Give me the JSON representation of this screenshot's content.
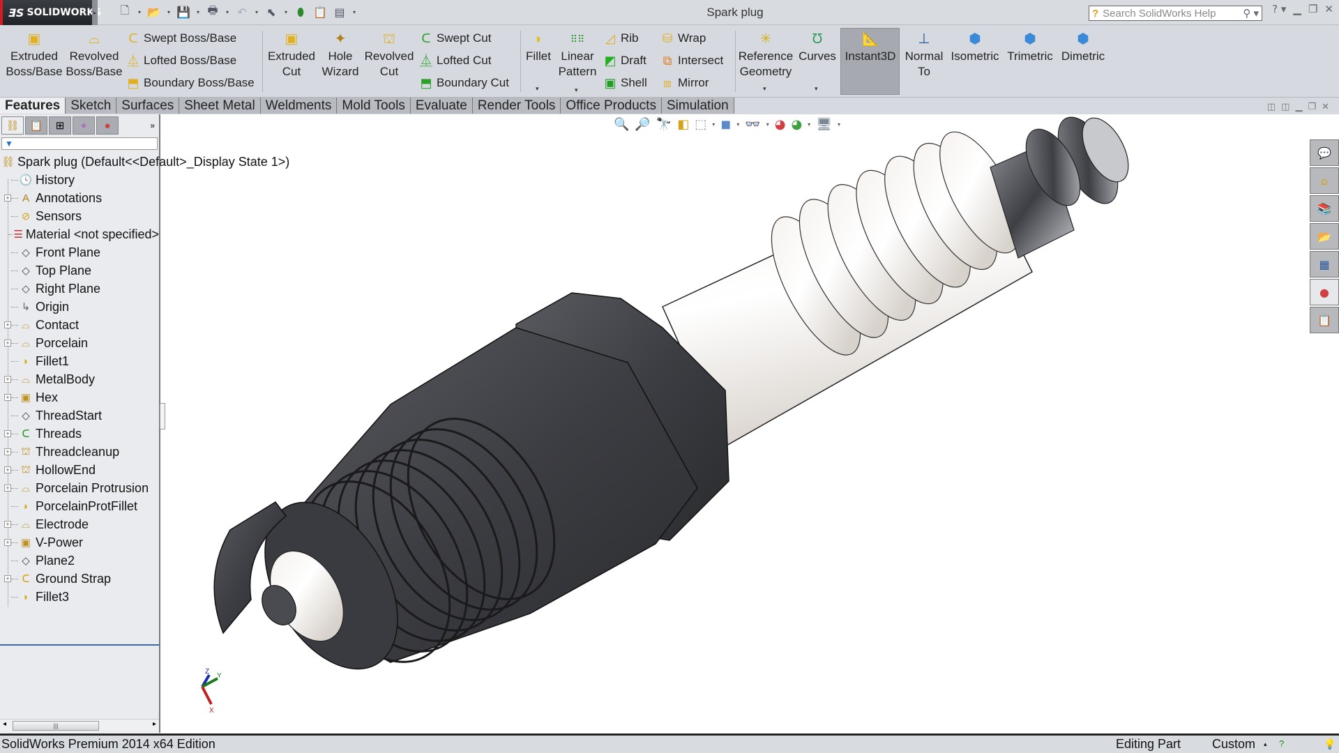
{
  "app": {
    "brand": "SOLIDWORKS",
    "document_title": "Spark plug",
    "search_placeholder": "Search SolidWorks Help"
  },
  "quick_access": [
    {
      "icon": "new-document-icon"
    },
    {
      "icon": "open-folder-icon"
    },
    {
      "icon": "save-icon"
    },
    {
      "icon": "print-icon"
    },
    {
      "icon": "undo-icon"
    },
    {
      "icon": "select-cursor-icon"
    },
    {
      "icon": "rebuild-icon"
    },
    {
      "icon": "file-properties-icon"
    },
    {
      "icon": "options-icon"
    }
  ],
  "command_manager": {
    "big_buttons": [
      {
        "id": "extruded-boss",
        "line1": "Extruded",
        "line2": "Boss/Base"
      },
      {
        "id": "revolved-boss",
        "line1": "Revolved",
        "line2": "Boss/Base"
      },
      {
        "id": "extruded-cut",
        "line1": "Extruded",
        "line2": "Cut"
      },
      {
        "id": "hole-wizard",
        "line1": "Hole",
        "line2": "Wizard"
      },
      {
        "id": "revolved-cut",
        "line1": "Revolved",
        "line2": "Cut"
      },
      {
        "id": "fillet",
        "line1": "Fillet",
        "line2": ""
      },
      {
        "id": "linear-pattern",
        "line1": "Linear",
        "line2": "Pattern"
      },
      {
        "id": "reference-geometry",
        "line1": "Reference",
        "line2": "Geometry"
      },
      {
        "id": "curves",
        "line1": "Curves",
        "line2": ""
      },
      {
        "id": "instant3d",
        "line1": "Instant3D",
        "line2": ""
      },
      {
        "id": "normal-to",
        "line1": "Normal",
        "line2": "To"
      },
      {
        "id": "isometric",
        "line1": "Isometric",
        "line2": ""
      },
      {
        "id": "trimetric",
        "line1": "Trimetric",
        "line2": ""
      },
      {
        "id": "dimetric",
        "line1": "Dimetric",
        "line2": ""
      }
    ],
    "small_buttons": [
      {
        "id": "swept-boss",
        "label": "Swept Boss/Base"
      },
      {
        "id": "lofted-boss",
        "label": "Lofted Boss/Base"
      },
      {
        "id": "boundary-boss",
        "label": "Boundary Boss/Base"
      },
      {
        "id": "swept-cut",
        "label": "Swept Cut"
      },
      {
        "id": "lofted-cut",
        "label": "Lofted Cut"
      },
      {
        "id": "boundary-cut",
        "label": "Boundary Cut"
      },
      {
        "id": "rib",
        "label": "Rib"
      },
      {
        "id": "draft",
        "label": "Draft"
      },
      {
        "id": "shell",
        "label": "Shell"
      },
      {
        "id": "wrap",
        "label": "Wrap"
      },
      {
        "id": "intersect",
        "label": "Intersect"
      },
      {
        "id": "mirror",
        "label": "Mirror"
      }
    ],
    "active": "Instant3D"
  },
  "tabs": [
    "Features",
    "Sketch",
    "Surfaces",
    "Sheet Metal",
    "Weldments",
    "Mold Tools",
    "Evaluate",
    "Render Tools",
    "Office Products",
    "Simulation"
  ],
  "active_tab": "Features",
  "feature_tree": {
    "panel_tabs": [
      "featuremanager-tab",
      "propertymanager-tab",
      "configurationmanager-tab",
      "dimxpert-tab",
      "display-manager-tab"
    ],
    "root": "Spark plug  (Default<<Default>_Display State 1>)",
    "items": [
      {
        "label": "History",
        "icon": "history-icon",
        "expandable": false
      },
      {
        "label": "Annotations",
        "icon": "annotations-icon",
        "expandable": true
      },
      {
        "label": "Sensors",
        "icon": "sensors-icon",
        "expandable": false
      },
      {
        "label": "Material <not specified>",
        "icon": "material-icon",
        "expandable": false
      },
      {
        "label": "Front Plane",
        "icon": "plane-icon",
        "expandable": false
      },
      {
        "label": "Top Plane",
        "icon": "plane-icon",
        "expandable": false
      },
      {
        "label": "Right Plane",
        "icon": "plane-icon",
        "expandable": false
      },
      {
        "label": "Origin",
        "icon": "origin-icon",
        "expandable": false
      },
      {
        "label": "Contact",
        "icon": "revolve-icon",
        "expandable": true
      },
      {
        "label": "Porcelain",
        "icon": "revolve-icon",
        "expandable": true
      },
      {
        "label": "Fillet1",
        "icon": "fillet-icon",
        "expandable": false
      },
      {
        "label": "MetalBody",
        "icon": "revolve-icon",
        "expandable": true
      },
      {
        "label": "Hex",
        "icon": "extrude-icon",
        "expandable": true
      },
      {
        "label": "ThreadStart",
        "icon": "plane-icon",
        "expandable": false
      },
      {
        "label": "Threads",
        "icon": "swept-cut-icon",
        "expandable": true
      },
      {
        "label": "Threadcleanup",
        "icon": "revolved-cut-icon",
        "expandable": true
      },
      {
        "label": "HollowEnd",
        "icon": "revolved-cut-icon",
        "expandable": true
      },
      {
        "label": "Porcelain Protrusion",
        "icon": "revolve-icon",
        "expandable": true
      },
      {
        "label": "PorcelainProtFillet",
        "icon": "fillet-icon",
        "expandable": false
      },
      {
        "label": "Electrode",
        "icon": "revolve-icon",
        "expandable": true
      },
      {
        "label": "V-Power",
        "icon": "extrude-icon",
        "expandable": true
      },
      {
        "label": "Plane2",
        "icon": "plane-icon",
        "expandable": false
      },
      {
        "label": "Ground Strap",
        "icon": "swept-boss-icon",
        "expandable": true
      },
      {
        "label": "Fillet3",
        "icon": "fillet-icon",
        "expandable": false
      }
    ]
  },
  "heads_up_toolbar": [
    "zoom-to-fit-icon",
    "zoom-to-area-icon",
    "previous-view-icon",
    "section-view-icon",
    "view-orientation-icon",
    "display-style-icon",
    "hide-show-items-icon",
    "edit-appearance-icon",
    "apply-scene-icon",
    "view-settings-icon"
  ],
  "task_pane": [
    "solidworks-resources-icon",
    "design-library-icon",
    "file-explorer-icon",
    "view-palette-icon",
    "appearances-icon",
    "custom-properties-icon",
    "forum-icon"
  ],
  "triad": {
    "x": "X",
    "y": "Y",
    "z": "Z"
  },
  "status_bar": {
    "edition": "SolidWorks Premium 2014 x64 Edition",
    "mode": "Editing Part",
    "units": "Custom"
  }
}
